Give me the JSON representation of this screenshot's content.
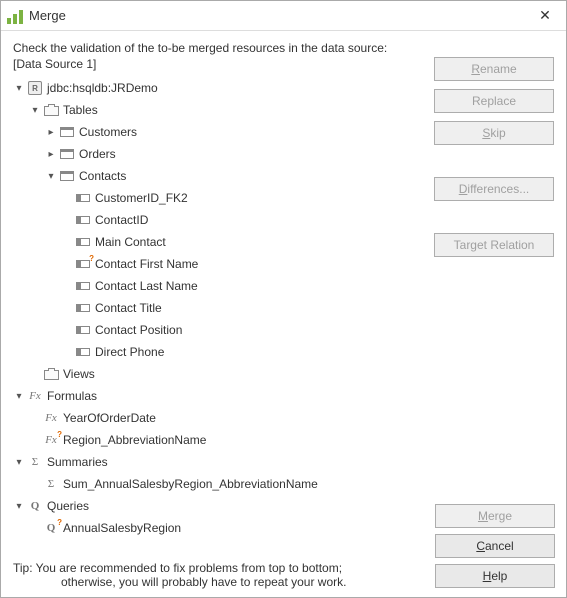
{
  "window": {
    "title": "Merge"
  },
  "instruction": "Check the validation of the to-be merged resources in the data source:",
  "data_source_label": "[Data Source 1]",
  "tip_line1": "Tip: You are recommended to fix problems from top to bottom;",
  "tip_line2": "otherwise, you will probably have to repeat your work.",
  "buttons": {
    "rename": "Rename",
    "replace": "Replace",
    "skip": "Skip",
    "differences": "Differences...",
    "target_relation": "Target Relation",
    "merge": "Merge",
    "cancel": "Cancel",
    "help": "Help"
  },
  "tree": [
    {
      "indent": 0,
      "exp": "down",
      "icon": "db",
      "badge": "R",
      "label": "jdbc:hsqldb:JRDemo"
    },
    {
      "indent": 1,
      "exp": "down",
      "icon": "folder",
      "label": "Tables"
    },
    {
      "indent": 2,
      "exp": "right",
      "icon": "table",
      "label": "Customers"
    },
    {
      "indent": 2,
      "exp": "right",
      "icon": "table",
      "label": "Orders"
    },
    {
      "indent": 2,
      "exp": "down",
      "icon": "table",
      "label": "Contacts"
    },
    {
      "indent": 3,
      "exp": "none",
      "icon": "col",
      "label": "CustomerID_FK2"
    },
    {
      "indent": 3,
      "exp": "none",
      "icon": "col",
      "label": "ContactID"
    },
    {
      "indent": 3,
      "exp": "none",
      "icon": "col",
      "label": "Main Contact"
    },
    {
      "indent": 3,
      "exp": "none",
      "icon": "col",
      "warn": true,
      "label": "Contact First Name"
    },
    {
      "indent": 3,
      "exp": "none",
      "icon": "col",
      "label": "Contact Last Name"
    },
    {
      "indent": 3,
      "exp": "none",
      "icon": "col",
      "label": "Contact Title"
    },
    {
      "indent": 3,
      "exp": "none",
      "icon": "col",
      "label": "Contact Position"
    },
    {
      "indent": 3,
      "exp": "none",
      "icon": "col",
      "label": "Direct Phone"
    },
    {
      "indent": 1,
      "exp": "none",
      "icon": "folder",
      "label": "Views"
    },
    {
      "indent": 0,
      "exp": "down",
      "icon": "fx",
      "label": "Formulas"
    },
    {
      "indent": 1,
      "exp": "none",
      "icon": "fx",
      "label": "YearOfOrderDate"
    },
    {
      "indent": 1,
      "exp": "none",
      "icon": "fx",
      "warn": true,
      "label": "Region_AbbreviationName"
    },
    {
      "indent": 0,
      "exp": "down",
      "icon": "sum",
      "label": "Summaries"
    },
    {
      "indent": 1,
      "exp": "none",
      "icon": "sum",
      "label": "Sum_AnnualSalesbyRegion_AbbreviationName"
    },
    {
      "indent": 0,
      "exp": "down",
      "icon": "q",
      "label": "Queries"
    },
    {
      "indent": 1,
      "exp": "none",
      "icon": "q",
      "warn": true,
      "label": "AnnualSalesbyRegion"
    }
  ]
}
